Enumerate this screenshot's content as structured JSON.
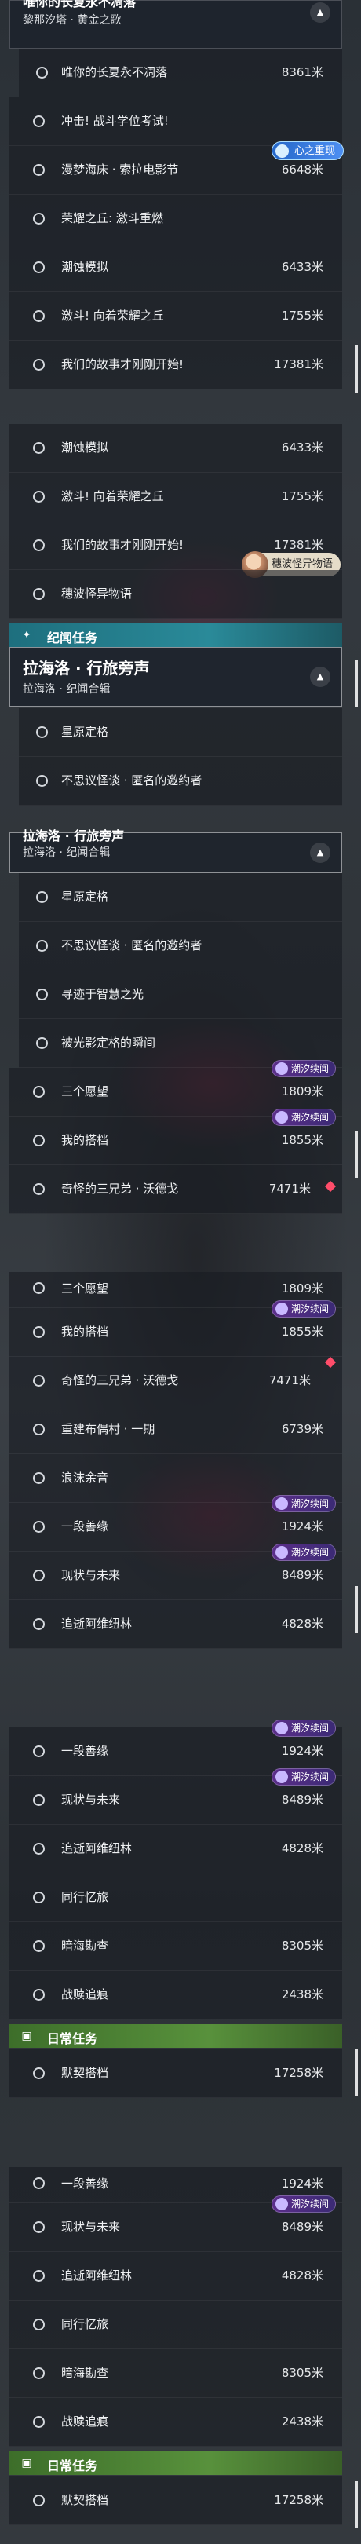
{
  "quest_card": {
    "title_partial": "唯你的长夏永不凋落",
    "subtitle": "黎那汐塔 · 黄金之歌"
  },
  "seg1": {
    "rows": [
      {
        "label": "唯你的长夏永不凋落",
        "dist": "8361米"
      },
      {
        "label": "冲击! 战斗学位考试!",
        "dist": ""
      },
      {
        "label": "漫梦海床 · 索拉电影节",
        "dist": "6648米"
      },
      {
        "label": "荣耀之丘: 激斗重燃",
        "dist": ""
      },
      {
        "label": "潮蚀模拟",
        "dist": "6433米"
      },
      {
        "label": "激斗! 向着荣耀之丘",
        "dist": "1755米"
      },
      {
        "label": "我们的故事才刚刚开始!",
        "dist": "17381米"
      }
    ],
    "top_badge": "心之重现"
  },
  "seg2": {
    "rows": [
      {
        "label": "潮蚀模拟",
        "dist": "6433米"
      },
      {
        "label": "激斗! 向着荣耀之丘",
        "dist": "1755米"
      },
      {
        "label": "我们的故事才刚刚开始!",
        "dist": "17381米"
      },
      {
        "label": "穗波怪异物语",
        "dist": ""
      }
    ],
    "npc_badge": "穗波怪异物语",
    "category": "纪闻任务",
    "quest_title": "拉海洛 · 行旅旁声",
    "quest_sub": "拉海洛 · 纪闻合辑",
    "sub_rows": [
      {
        "label": "星原定格"
      },
      {
        "label": "不思议怪谈 · 匿名的邀约者"
      }
    ]
  },
  "seg3": {
    "header_partial": "拉海洛 · 行旅旁声",
    "header_sub": "拉海洛 · 纪闻合辑",
    "sub_rows": [
      {
        "label": "星原定格",
        "dist": ""
      },
      {
        "label": "不思议怪谈 · 匿名的邀约者",
        "dist": ""
      },
      {
        "label": "寻迹于智慧之光",
        "dist": ""
      },
      {
        "label": "被光影定格的瞬间",
        "dist": ""
      }
    ],
    "rows": [
      {
        "label": "三个愿望",
        "dist": "1809米",
        "badge": "潮汐续闻"
      },
      {
        "label": "我的搭档",
        "dist": "1855米",
        "badge": "潮汐续闻"
      },
      {
        "label": "奇怪的三兄弟 · 沃德戈",
        "dist": "7471米",
        "badge": ""
      }
    ]
  },
  "seg4": {
    "rows": [
      {
        "label": "三个愿望",
        "dist": "1809米",
        "badge": ""
      },
      {
        "label": "我的搭档",
        "dist": "1855米",
        "badge": "潮汐续闻"
      },
      {
        "label": "奇怪的三兄弟 · 沃德戈",
        "dist": "7471米",
        "badge": ""
      },
      {
        "label": "重建布偶村 · 一期",
        "dist": "6739米",
        "badge": ""
      },
      {
        "label": "浪沫余音",
        "dist": "",
        "badge": ""
      },
      {
        "label": "一段善缘",
        "dist": "1924米",
        "badge": "潮汐续闻"
      },
      {
        "label": "现状与未来",
        "dist": "8489米",
        "badge": "潮汐续闻"
      },
      {
        "label": "追逝阿维纽林",
        "dist": "4828米",
        "badge": ""
      }
    ]
  },
  "seg5": {
    "rows": [
      {
        "label": "一段善缘",
        "dist": "1924米",
        "badge": "潮汐续闻"
      },
      {
        "label": "现状与未来",
        "dist": "8489米",
        "badge": "潮汐续闻"
      },
      {
        "label": "追逝阿维纽林",
        "dist": "4828米",
        "badge": ""
      },
      {
        "label": "同行忆旅",
        "dist": "",
        "badge": ""
      },
      {
        "label": "暗海勘查",
        "dist": "8305米",
        "badge": ""
      },
      {
        "label": "战赎追痕",
        "dist": "2438米",
        "badge": ""
      }
    ],
    "category": "日常任务",
    "daily": {
      "label": "默契搭档",
      "dist": "17258米"
    }
  },
  "seg6": {
    "rows": [
      {
        "label": "一段善缘",
        "dist": "1924米",
        "badge": ""
      },
      {
        "label": "现状与未来",
        "dist": "8489米",
        "badge": "潮汐续闻"
      },
      {
        "label": "追逝阿维纽林",
        "dist": "4828米",
        "badge": ""
      },
      {
        "label": "同行忆旅",
        "dist": "",
        "badge": ""
      },
      {
        "label": "暗海勘查",
        "dist": "8305米",
        "badge": ""
      },
      {
        "label": "战赎追痕",
        "dist": "2438米",
        "badge": ""
      }
    ],
    "category": "日常任务",
    "daily": {
      "label": "默契搭档",
      "dist": "17258米"
    }
  },
  "colors": {
    "jiwen_header": "#2a8a99",
    "daily_header": "#58913c",
    "badge": "#5b2e8a"
  }
}
